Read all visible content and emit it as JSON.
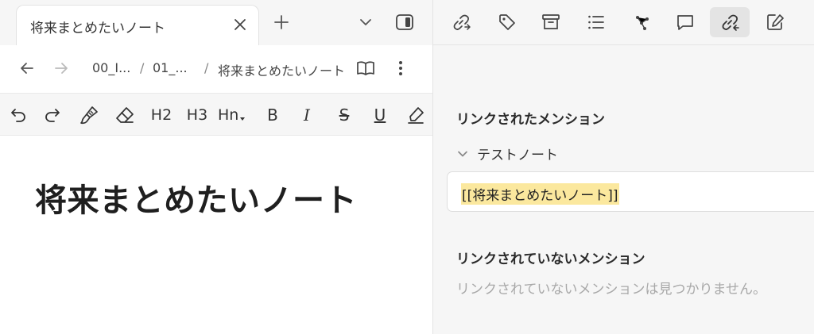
{
  "tabs": [
    {
      "title": "将来まとめたいノート",
      "active": true
    }
  ],
  "breadcrumb": [
    {
      "label": "00_I..."
    },
    {
      "label": "01_..."
    },
    {
      "label": "将来まとめたいノート"
    }
  ],
  "breadcrumb_separator": "/",
  "editor_toolbar": {
    "h2": "H2",
    "h3": "H3",
    "hn": "Hn",
    "bold": "B",
    "italic": "I",
    "strike": "S",
    "underline": "U"
  },
  "note": {
    "title": "将来まとめたいノート"
  },
  "backlinks": {
    "linked_title": "リンクされたメンション",
    "group_label": "テストノート",
    "mention_text": "[[将来まとめたいノート]]",
    "unlinked_title": "リンクされていないメンション",
    "unlinked_empty": "リンクされていないメンションは見つかりません。"
  },
  "colors": {
    "highlight": "#fbe89e",
    "panel_bg": "#f6f6f6",
    "active_tool_bg": "#e4e4e4"
  },
  "icons": {
    "tab_bar": [
      "close-icon",
      "plus-icon",
      "chevron-down-icon",
      "sidebar-toggle-icon"
    ],
    "nav": [
      "arrow-left-icon",
      "arrow-right-icon",
      "book-icon",
      "more-vertical-icon"
    ],
    "editor_toolbar": [
      "undo-icon",
      "redo-icon",
      "paint-brush-icon",
      "eraser-icon",
      "highlighter-icon"
    ],
    "right_toolbar": [
      "outgoing-links-icon",
      "tag-icon",
      "archive-icon",
      "outline-icon",
      "graph-icon",
      "comment-icon",
      "backlinks-icon",
      "edit-icon"
    ]
  }
}
